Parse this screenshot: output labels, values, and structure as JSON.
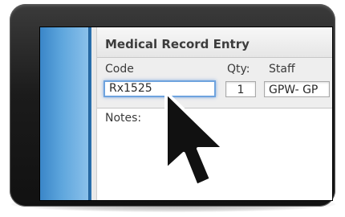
{
  "window": {
    "title": "Medical Record Entry"
  },
  "form": {
    "code_label": "Code",
    "code_value": "Rx1525",
    "qty_label": "Qty:",
    "qty_value": "1",
    "staff_label": "Staff",
    "staff_value": "GPW- GP",
    "notes_label": "Notes:"
  },
  "icons": {
    "pointer": "mouse-pointer-arrow-icon"
  },
  "colors": {
    "sidebar_blue": "#5ea6dd",
    "focus_ring": "#6ea3de",
    "device_bezel": "#1b1b1b"
  }
}
